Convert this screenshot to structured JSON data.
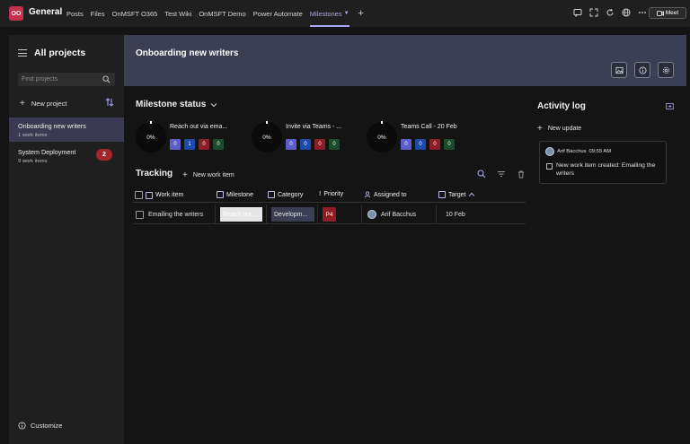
{
  "topbar": {
    "team_logo": "OO",
    "channel": "General",
    "tabs": [
      {
        "label": "Posts"
      },
      {
        "label": "Files"
      },
      {
        "label": "OnMSFT O365"
      },
      {
        "label": "Test Wiki"
      },
      {
        "label": "OnMSFT Demo"
      },
      {
        "label": "Power Automate"
      },
      {
        "label": "Milestones",
        "active": true
      }
    ],
    "meet_label": "Meet"
  },
  "sidebar": {
    "title": "All projects",
    "search_placeholder": "Find projects",
    "new_project_label": "New project",
    "projects": [
      {
        "name": "Onboarding new writers",
        "sub": "1 work items",
        "selected": true
      },
      {
        "name": "System Deployment",
        "sub": "9 work items",
        "badge": "2"
      }
    ],
    "customize_label": "Customize"
  },
  "main": {
    "title": "Onboarding new writers",
    "milestone_status_title": "Milestone status",
    "milestones": [
      {
        "name": "Reach out via ema...",
        "percent": "0%",
        "counts": [
          "0",
          "1",
          "0",
          "0"
        ]
      },
      {
        "name": "Invite via Teams - ...",
        "percent": "0%",
        "counts": [
          "0",
          "0",
          "0",
          "0"
        ]
      },
      {
        "name": "Teams Call - 20 Feb",
        "percent": "0%",
        "counts": [
          "0",
          "0",
          "0",
          "0"
        ]
      }
    ],
    "count_colors": [
      "#5b5fc7",
      "#1b4aa8",
      "#8c1f25",
      "#1c4a2a"
    ],
    "tracking": {
      "title": "Tracking",
      "new_work_label": "New work item",
      "columns": {
        "work_item": "Work item",
        "milestone": "Milestone",
        "category": "Category",
        "priority": "Priority",
        "assigned_to": "Assigned to",
        "target": "Target"
      },
      "rows": [
        {
          "work_item": "Emailing the writers",
          "milestone": "Reach out...",
          "category": "Developm...",
          "priority": "P4",
          "assigned_to": "Arif Bacchus",
          "target": "10 Feb"
        }
      ]
    }
  },
  "activity_log": {
    "title": "Activity log",
    "new_update_label": "New update",
    "entries": [
      {
        "user": "Arif Bacchus",
        "time": "09:55 AM",
        "message": "New work item created: Emailing the writers"
      }
    ]
  }
}
